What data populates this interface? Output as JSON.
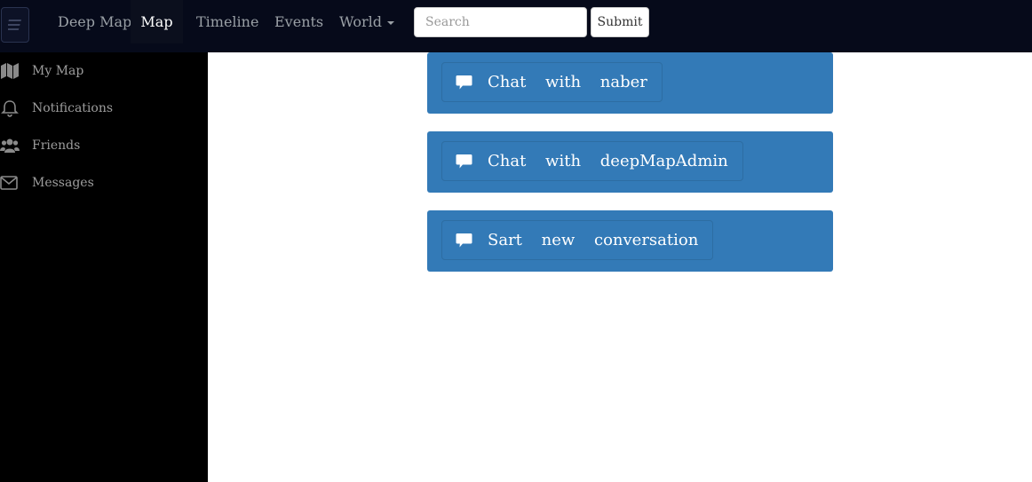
{
  "navbar": {
    "brand": "Deep Map",
    "links": [
      {
        "label": "Map",
        "active": true
      },
      {
        "label": "Timeline"
      },
      {
        "label": "Events"
      },
      {
        "label": "World"
      }
    ],
    "search": {
      "placeholder": "Search",
      "value": ""
    },
    "submit_label": "Submit"
  },
  "sidebar": {
    "items": [
      {
        "label": "My Map",
        "icon": "map-icon"
      },
      {
        "label": "Notifications",
        "icon": "bell-icon"
      },
      {
        "label": "Friends",
        "icon": "users-icon"
      },
      {
        "label": "Messages",
        "icon": "envelope-icon"
      }
    ]
  },
  "main": {
    "conversations": [
      {
        "label": "Chat with naber",
        "icon": "comment-icon"
      },
      {
        "label": "Chat with deepMapAdmin",
        "icon": "comment-icon"
      },
      {
        "label": "Sart new conversation",
        "icon": "comment-icon"
      }
    ]
  },
  "colors": {
    "navbar_bg": "#060a1a",
    "sidebar_bg": "#000000",
    "panel_bg": "#337ab7",
    "text_muted": "#9d9d9d"
  }
}
